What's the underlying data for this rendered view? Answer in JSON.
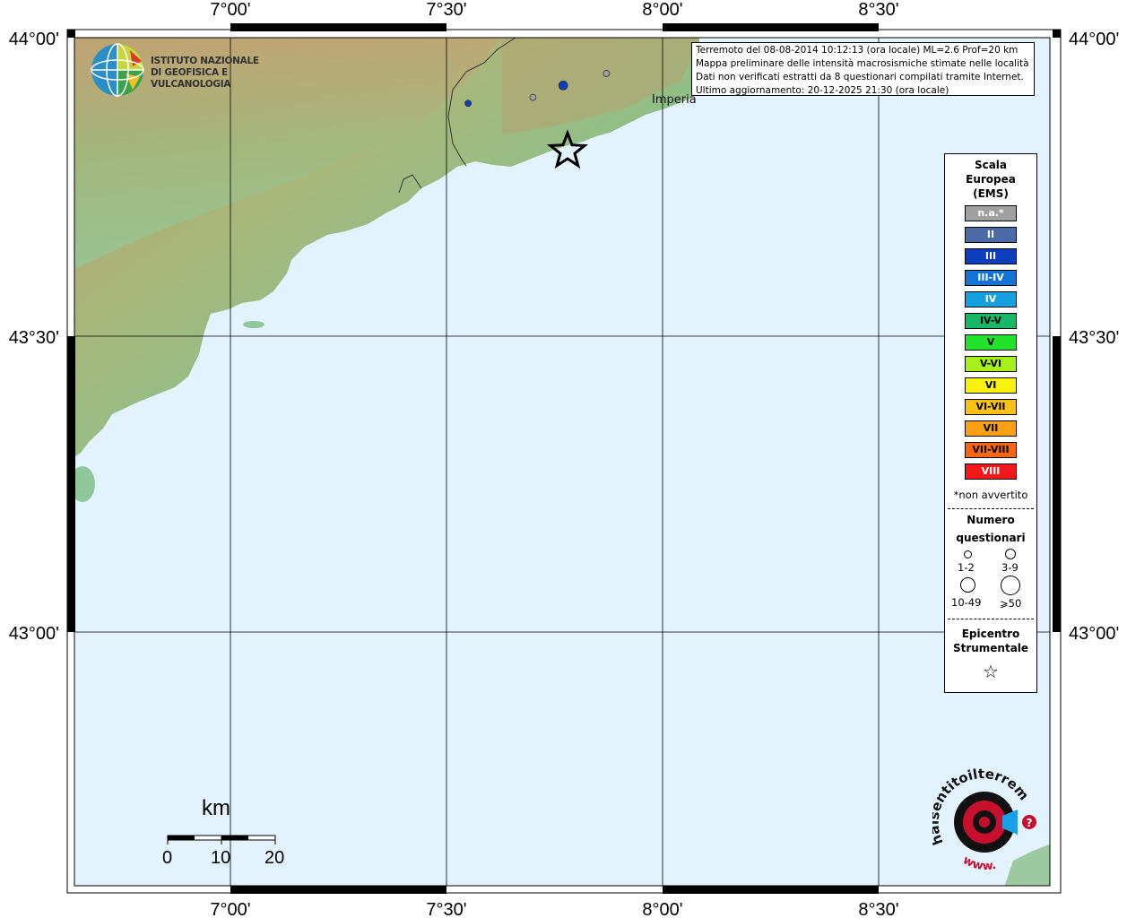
{
  "info": {
    "line1": "Terremoto del 08-08-2014 10:12:13 (ora locale) ML=2.6 Prof=20 km",
    "line2": "Mappa preliminare delle intensità macrosismiche stimate nelle località",
    "line3": "Dati non verificati estratti da 8 questionari compilati tramite Internet.",
    "line4": "Ultimo aggiornamento: 20-12-2025 21:30 (ora locale)"
  },
  "axes": {
    "lon_labels": [
      "7°00'",
      "7°30'",
      "8°00'",
      "8°30'"
    ],
    "lat_labels": [
      "44°00'",
      "43°30'",
      "43°00'"
    ]
  },
  "city": {
    "name": "Imperia"
  },
  "logo": {
    "ingv_line1": "ISTITUTO NAZIONALE",
    "ingv_line2": "DI GEOFISICA E VULCANOLOGIA",
    "hst_text": "haisentitoilterremoto.it",
    "hst_www": "www."
  },
  "legend": {
    "title_line1": "Scala",
    "title_line2": "Europea",
    "title_line3": "(EMS)",
    "scale": [
      {
        "label": "n.a.*",
        "color": "#a0a0a0",
        "text_color": "#ffffff"
      },
      {
        "label": "II",
        "color": "#4a6aa8",
        "text_color": "#ffffff"
      },
      {
        "label": "III",
        "color": "#0b3dbd",
        "text_color": "#ffffff"
      },
      {
        "label": "III-IV",
        "color": "#1374d6",
        "text_color": "#ffffff"
      },
      {
        "label": "IV",
        "color": "#16a0e0",
        "text_color": "#ffffff"
      },
      {
        "label": "IV-V",
        "color": "#16b866",
        "text_color": "#000000"
      },
      {
        "label": "V",
        "color": "#22e22a",
        "text_color": "#000000"
      },
      {
        "label": "V-VI",
        "color": "#a8f01a",
        "text_color": "#000000"
      },
      {
        "label": "VI",
        "color": "#fbf10f",
        "text_color": "#000000"
      },
      {
        "label": "VI-VII",
        "color": "#fbc114",
        "text_color": "#000000"
      },
      {
        "label": "VII",
        "color": "#fb9f14",
        "text_color": "#000000"
      },
      {
        "label": "VII-VIII",
        "color": "#f8660f",
        "text_color": "#000000"
      },
      {
        "label": "VIII",
        "color": "#f51818",
        "text_color": "#ffffff"
      }
    ],
    "note": "*non avvertito",
    "count_title_line1": "Numero",
    "count_title_line2": "questionari",
    "sizes": [
      "1-2",
      "3-9",
      "10-49",
      "⩾50"
    ],
    "epicenter_line1": "Epicentro",
    "epicenter_line2": "Strumentale"
  },
  "scalebar": {
    "unit": "km",
    "ticks": [
      "0",
      "10",
      "20"
    ]
  },
  "observations": [
    {
      "lon": 7.55,
      "lat": 43.89,
      "intensity": "III",
      "count": "1-2"
    },
    {
      "lon": 7.7,
      "lat": 43.9,
      "intensity": "n.a.*",
      "count": "1-2"
    },
    {
      "lon": 7.77,
      "lat": 43.92,
      "intensity": "III",
      "count": "3-9"
    },
    {
      "lon": 7.87,
      "lat": 43.94,
      "intensity": "n.a.*",
      "count": "1-2"
    }
  ],
  "epicenter": {
    "lon": 7.78,
    "lat": 43.81
  },
  "colors": {
    "sea": "#e2f3fd",
    "coast_green": "#8fc69a",
    "relief_brown": "#b4966a",
    "grid": "#000000",
    "epicenter_stroke": "#000000"
  }
}
